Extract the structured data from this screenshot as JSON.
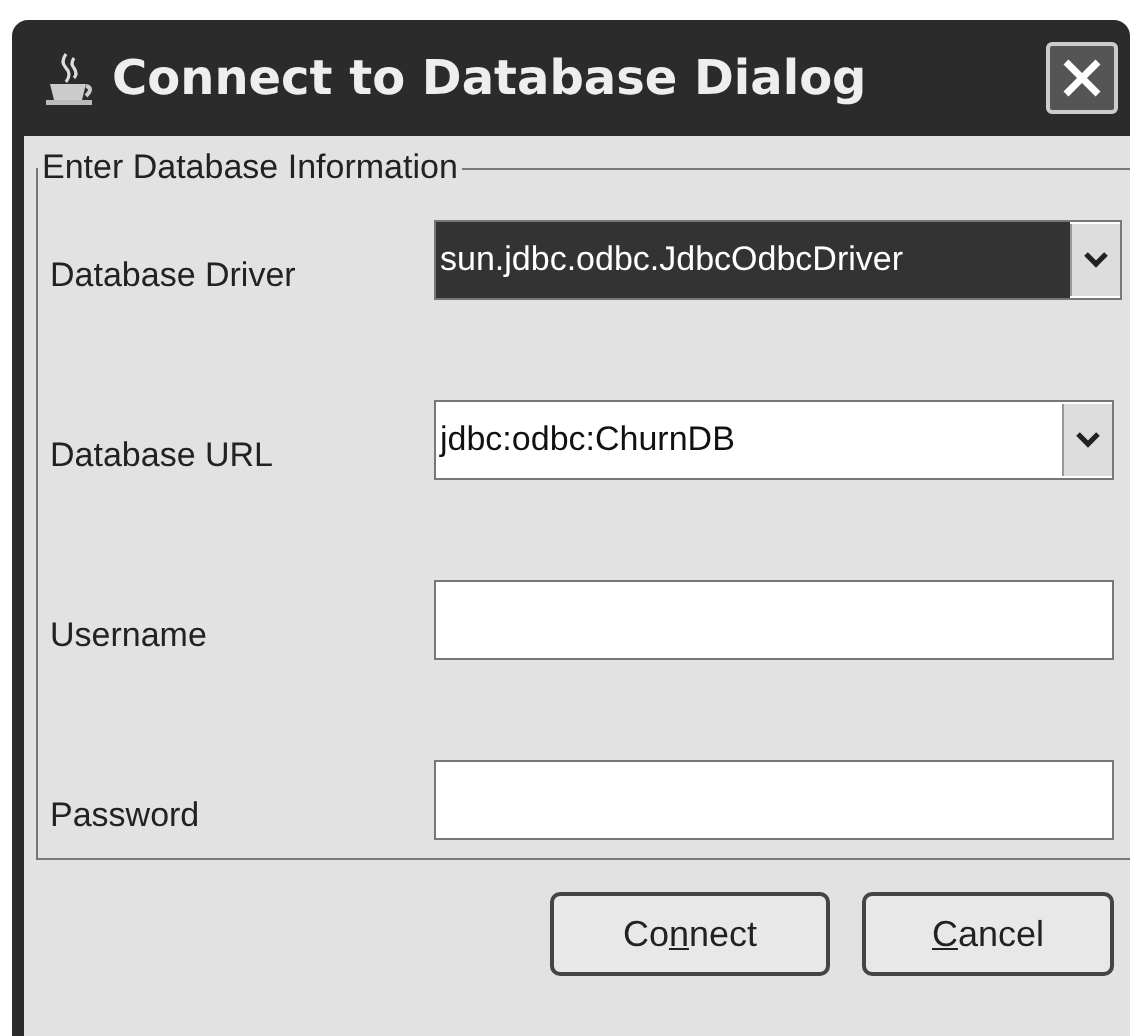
{
  "window": {
    "title": "Connect to Database Dialog"
  },
  "group": {
    "title": "Enter Database Information"
  },
  "fields": [
    {
      "kind": "combo",
      "label": "Database Driver",
      "value": "sun.jdbc.odbc.JdbcOdbcDriver",
      "selected": true
    },
    {
      "kind": "combo",
      "label": "Database URL",
      "value": "jdbc:odbc:ChurnDB",
      "selected": false
    },
    {
      "kind": "text",
      "label": "Username"
    },
    {
      "kind": "password",
      "label": "Password"
    }
  ],
  "buttons": [
    {
      "label_runs": [
        {
          "text": "Co",
          "underlined": false
        },
        {
          "text": "n",
          "underlined": true
        },
        {
          "text": "nect",
          "underlined": false
        }
      ]
    },
    {
      "label_runs": [
        {
          "text": "C",
          "underlined": true
        },
        {
          "text": "ancel",
          "underlined": false
        }
      ]
    }
  ]
}
